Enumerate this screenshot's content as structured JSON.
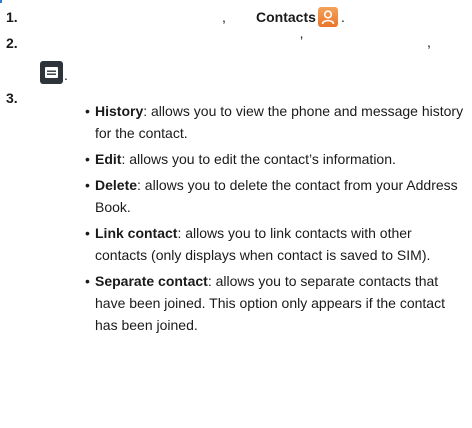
{
  "steps": [
    {
      "number": "1.",
      "bold_label": "Contacts",
      "punct_comma": ",",
      "punct_period": "."
    },
    {
      "number": "2.",
      "mark_a": "’",
      "mark_b": ",",
      "trailing": "."
    },
    {
      "number": "3."
    }
  ],
  "options": [
    {
      "term": "History",
      "desc": ": allows you to view the phone and message history for the contact."
    },
    {
      "term": "Edit",
      "desc": ": allows you to edit the contact’s information."
    },
    {
      "term": "Delete",
      "desc": ": allows you to delete the contact from your Address Book."
    },
    {
      "term": "Link contact",
      "desc": ": allows you to link contacts with other contacts (only displays when contact is saved to SIM)."
    },
    {
      "term": "Separate contact",
      "desc": ": allows you to separate contacts that have been joined. This option only appears if the contact has been joined."
    }
  ],
  "bullet": "•",
  "icons": {
    "contacts": "contacts-icon",
    "menu": "menu-key-icon"
  },
  "colors": {
    "contacts_icon": "#ef8a3c",
    "menu_icon": "#2f343a",
    "text": "#1a1a1a"
  }
}
